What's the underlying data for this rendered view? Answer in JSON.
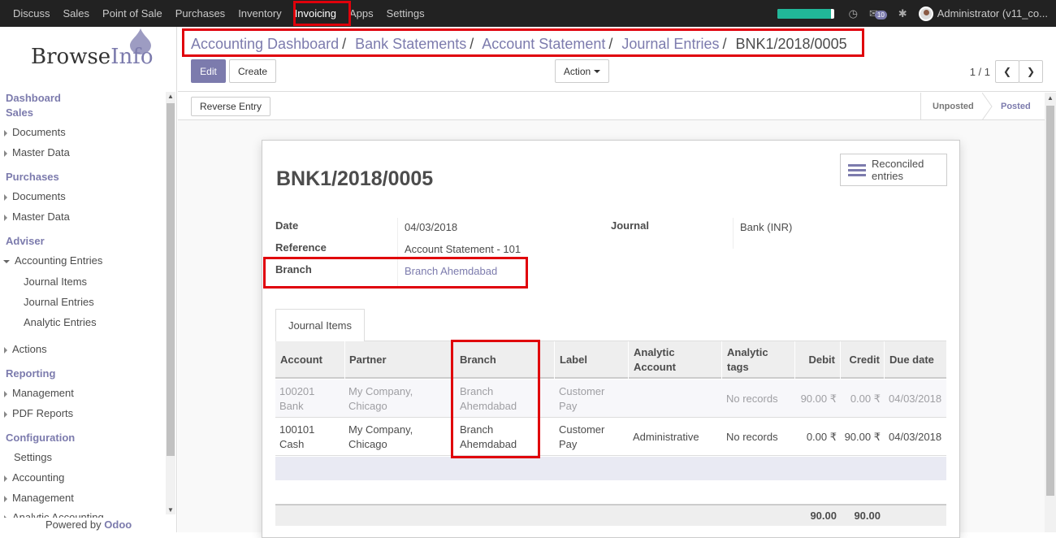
{
  "topbar": {
    "menus": [
      "Discuss",
      "Sales",
      "Point of Sale",
      "Purchases",
      "Inventory",
      "Invoicing",
      "Apps",
      "Settings"
    ],
    "active": "Invoicing",
    "progress_fraction": 0.95,
    "chat_badge": "10",
    "user": "Administrator (v11_co..."
  },
  "sidebar": {
    "logo_browse": "Browse",
    "logo_info": "Info",
    "sections": {
      "dashboard": "Dashboard",
      "sales": "Sales",
      "sales_documents": "Documents",
      "sales_master": "Master Data",
      "purchases": "Purchases",
      "purch_documents": "Documents",
      "purch_master": "Master Data",
      "adviser": "Adviser",
      "accounting_entries": "Accounting Entries",
      "journal_items": "Journal Items",
      "journal_entries": "Journal Entries",
      "analytic_entries": "Analytic Entries",
      "actions": "Actions",
      "reporting": "Reporting",
      "management": "Management",
      "pdf_reports": "PDF Reports",
      "configuration": "Configuration",
      "settings": "Settings",
      "accounting": "Accounting",
      "conf_management": "Management",
      "analytic_accounting": "Analytic Accounting"
    },
    "powered_by": "Powered by",
    "odoo": "Odoo"
  },
  "breadcrumb": {
    "items": [
      "Accounting Dashboard",
      "Bank Statements",
      "Account Statement",
      "Journal Entries"
    ],
    "current": "BNK1/2018/0005",
    "sep": "/"
  },
  "toolbar": {
    "edit": "Edit",
    "create": "Create",
    "action": "Action",
    "pager": "1 / 1",
    "reverse": "Reverse Entry"
  },
  "status": {
    "unposted": "Unposted",
    "posted": "Posted"
  },
  "form": {
    "title": "BNK1/2018/0005",
    "reconciled_1": "Reconciled",
    "reconciled_2": "entries",
    "date_label": "Date",
    "date_value": "04/03/2018",
    "ref_label": "Reference",
    "ref_value": "Account Statement - 101",
    "branch_label": "Branch",
    "branch_value": "Branch Ahemdabad",
    "journal_label": "Journal",
    "journal_value": "Bank (INR)"
  },
  "tab_label": "Journal Items",
  "table": {
    "headers": {
      "account": "Account",
      "partner": "Partner",
      "branch": "Branch",
      "label": "Label",
      "analytic_1": "Analytic",
      "analytic_2": "Account",
      "tags_1": "Analytic",
      "tags_2": "tags",
      "debit": "Debit",
      "credit": "Credit",
      "due": "Due date"
    },
    "rows": [
      {
        "acc1": "100201",
        "acc2": "Bank",
        "p1": "My Company,",
        "p2": "Chicago",
        "b1": "Branch",
        "b2": "Ahemdabad",
        "l1": "Customer",
        "l2": "Pay",
        "analytic": "",
        "tags": "No records",
        "debit": "90.00 ₹",
        "credit": "0.00 ₹",
        "due": "04/03/2018"
      },
      {
        "acc1": "100101",
        "acc2": "Cash",
        "p1": "My Company,",
        "p2": "Chicago",
        "b1": "Branch",
        "b2": "Ahemdabad",
        "l1": "Customer",
        "l2": "Pay",
        "analytic": "Administrative",
        "tags": "No records",
        "debit": "0.00 ₹",
        "credit": "90.00 ₹",
        "due": "04/03/2018"
      }
    ],
    "total_debit": "90.00",
    "total_credit": "90.00"
  },
  "colors": {
    "accent": "#7c7bad",
    "highlight": "#e0000b",
    "topbar": "#222222"
  }
}
